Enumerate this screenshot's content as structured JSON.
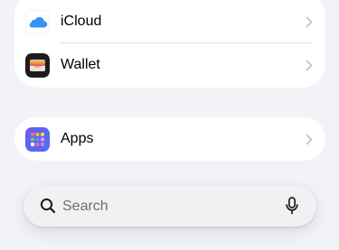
{
  "settings": {
    "rows": [
      {
        "label": "iCloud",
        "icon": "icloud-icon"
      },
      {
        "label": "Wallet",
        "icon": "wallet-icon"
      }
    ],
    "apps_row": {
      "label": "Apps",
      "icon": "apps-icon"
    }
  },
  "search": {
    "placeholder": "Search",
    "value": ""
  },
  "colors": {
    "background": "#f2f2f7",
    "card": "#ffffff",
    "chevron": "#c4c4c7",
    "icloud_blue": "#3a8ff7"
  }
}
